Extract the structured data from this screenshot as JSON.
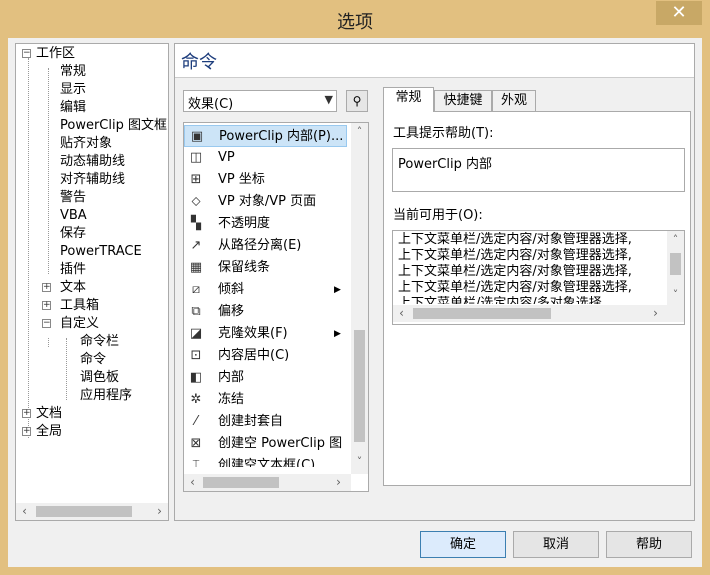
{
  "window": {
    "title": "选项",
    "close_glyph": "✕"
  },
  "tree": {
    "nodes": [
      {
        "label": "工作区",
        "expander": "−"
      },
      {
        "label": "常规"
      },
      {
        "label": "显示"
      },
      {
        "label": "编辑"
      },
      {
        "label": "PowerClip 图文框"
      },
      {
        "label": "贴齐对象"
      },
      {
        "label": "动态辅助线"
      },
      {
        "label": "对齐辅助线"
      },
      {
        "label": "警告"
      },
      {
        "label": "VBA"
      },
      {
        "label": "保存"
      },
      {
        "label": "PowerTRACE"
      },
      {
        "label": "插件"
      },
      {
        "label": "文本",
        "expander": "+"
      },
      {
        "label": "工具箱",
        "expander": "+"
      },
      {
        "label": "自定义",
        "expander": "−"
      },
      {
        "label": "命令栏"
      },
      {
        "label": "命令"
      },
      {
        "label": "调色板"
      },
      {
        "label": "应用程序"
      },
      {
        "label": "文档",
        "expander": "+"
      },
      {
        "label": "全局",
        "expander": "+"
      }
    ]
  },
  "panel": {
    "title": "命令"
  },
  "category_combo": {
    "value": "效果(C)"
  },
  "find_button": {
    "icon": "binoculars-icon",
    "glyph": "⚲"
  },
  "commands": [
    {
      "label": "PowerClip 内部(P)...",
      "icon": "powerclip-inside-icon",
      "glyph": "▣"
    },
    {
      "label": "VP",
      "icon": "vp-icon",
      "glyph": "◫"
    },
    {
      "label": "VP 坐标",
      "icon": "vp-coords-icon",
      "glyph": "⊞"
    },
    {
      "label": "VP 对象/VP 页面",
      "icon": "vp-object-icon",
      "glyph": "⬦"
    },
    {
      "label": "不透明度",
      "icon": "opacity-icon",
      "glyph": "▚"
    },
    {
      "label": "从路径分离(E)",
      "icon": "separate-path-icon",
      "glyph": "↗"
    },
    {
      "label": "保留线条",
      "icon": "keep-lines-icon",
      "glyph": "▦"
    },
    {
      "label": "倾斜",
      "icon": "skew-icon",
      "glyph": "⧄"
    },
    {
      "label": "偏移",
      "icon": "offset-icon",
      "glyph": "⧉"
    },
    {
      "label": "克隆效果(F)",
      "icon": "clone-effect-icon",
      "glyph": "◪"
    },
    {
      "label": "内容居中(C)",
      "icon": "center-content-icon",
      "glyph": "⊡"
    },
    {
      "label": "内部",
      "icon": "inside-icon",
      "glyph": "◧"
    },
    {
      "label": "冻结",
      "icon": "freeze-icon",
      "glyph": "✲"
    },
    {
      "label": "创建封套自",
      "icon": "create-envelope-icon",
      "glyph": "⁄"
    },
    {
      "label": "创建空 PowerClip 图",
      "icon": "empty-powerclip-icon",
      "glyph": "⊠"
    },
    {
      "label": "创建空文本框(C)",
      "icon": "empty-textframe-icon",
      "glyph": "⌶"
    }
  ],
  "tabs": [
    {
      "label": "常规"
    },
    {
      "label": "快捷键"
    },
    {
      "label": "外观"
    }
  ],
  "general": {
    "tooltip_label": "工具提示帮助(T):",
    "tooltip_value": "PowerClip 内部",
    "available_label": "当前可用于(O):",
    "available_lines": [
      "上下文菜单栏/选定内容/对象管理器选择,",
      "上下文菜单栏/选定内容/对象管理器选择,",
      "上下文菜单栏/选定内容/对象管理器选择,",
      "上下文菜单栏/选定内容/对象管理器选择,",
      "上下文菜单栏/选定内容/多对象选择"
    ]
  },
  "buttons": {
    "ok": "确定",
    "cancel": "取消",
    "help": "帮助"
  },
  "colors": {
    "frame": "#e2c080",
    "selection": "#cce4f7",
    "title_text": "#1c3c7c"
  }
}
